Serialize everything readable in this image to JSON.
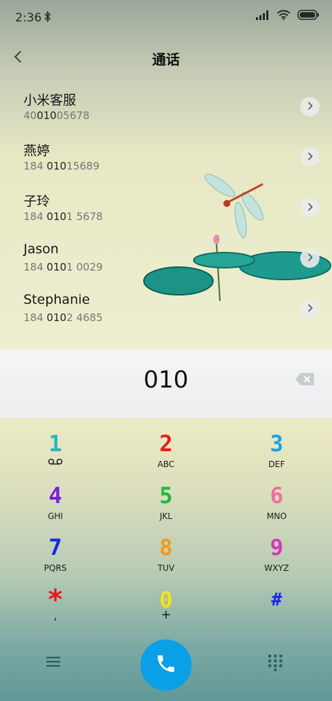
{
  "status": {
    "time": "2:36"
  },
  "header": {
    "title": "通话"
  },
  "contacts": [
    {
      "name": "小米客服",
      "number_pre": "40",
      "number_match": "010",
      "number_post": "05678"
    },
    {
      "name": "燕婷",
      "number_pre": "184 ",
      "number_match": "010",
      "number_post": "15689"
    },
    {
      "name": "子玲",
      "number_pre": "184 ",
      "number_match": "010",
      "number_post": "1 5678"
    },
    {
      "name": "Jason",
      "number_pre": "184 ",
      "number_match": "010",
      "number_post": "1 0029"
    },
    {
      "name": "Stephanie",
      "number_pre": "184 ",
      "number_match": "010",
      "number_post": "2 4685"
    }
  ],
  "dial": {
    "number": "010"
  },
  "keypad": [
    {
      "digit": "1",
      "letters": "",
      "color": "#2bb3c6"
    },
    {
      "digit": "2",
      "letters": "ABC",
      "color": "#e31b1b"
    },
    {
      "digit": "3",
      "letters": "DEF",
      "color": "#1aa3e6"
    },
    {
      "digit": "4",
      "letters": "GHI",
      "color": "#7b1fe0"
    },
    {
      "digit": "5",
      "letters": "JKL",
      "color": "#21b83a"
    },
    {
      "digit": "6",
      "letters": "MNO",
      "color": "#f06ea0"
    },
    {
      "digit": "7",
      "letters": "PQRS",
      "color": "#1428e8"
    },
    {
      "digit": "8",
      "letters": "TUV",
      "color": "#f39a1e"
    },
    {
      "digit": "9",
      "letters": "WXYZ",
      "color": "#d437b8"
    },
    {
      "digit": "*",
      "letters": ",",
      "color": "#e31b1b"
    },
    {
      "digit": "0",
      "letters": "+",
      "color": "#f4e21a"
    },
    {
      "digit": "#",
      "letters": "",
      "color": "#1428e8"
    }
  ],
  "icons": {
    "back": "chevron-left-icon",
    "detail": "chevron-right-icon",
    "backspace": "backspace-icon",
    "call": "phone-icon",
    "menu": "menu-icon",
    "dialpad": "dialpad-icon"
  },
  "colors": {
    "call_button": "#0aa0e6"
  }
}
